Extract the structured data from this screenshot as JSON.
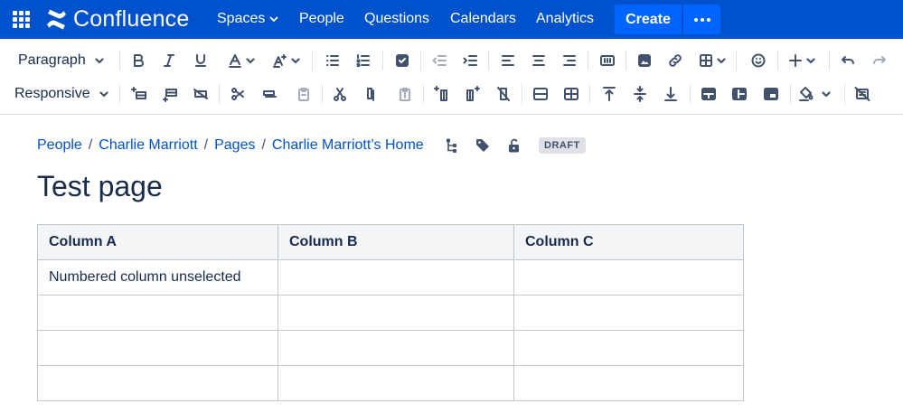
{
  "topnav": {
    "app_name": "Confluence",
    "items": [
      {
        "label": "Spaces",
        "has_dropdown": true
      },
      {
        "label": "People"
      },
      {
        "label": "Questions"
      },
      {
        "label": "Calendars"
      },
      {
        "label": "Analytics"
      }
    ],
    "create_label": "Create",
    "colors": {
      "bar": "#0052cc",
      "create": "#0065ff"
    }
  },
  "toolbar": {
    "paragraph_label": "Paragraph",
    "responsive_label": "Responsive"
  },
  "breadcrumb": {
    "items": [
      "People",
      "Charlie Marriott",
      "Pages",
      "Charlie Marriott’s Home"
    ],
    "separator": "/",
    "status": "DRAFT"
  },
  "page": {
    "title": "Test page"
  },
  "table": {
    "headers": [
      "Column A",
      "Column B",
      "Column C"
    ],
    "rows": [
      [
        "Numbered column unselected",
        "",
        ""
      ],
      [
        "",
        "",
        ""
      ],
      [
        "",
        "",
        ""
      ],
      [
        "",
        "",
        ""
      ]
    ]
  }
}
